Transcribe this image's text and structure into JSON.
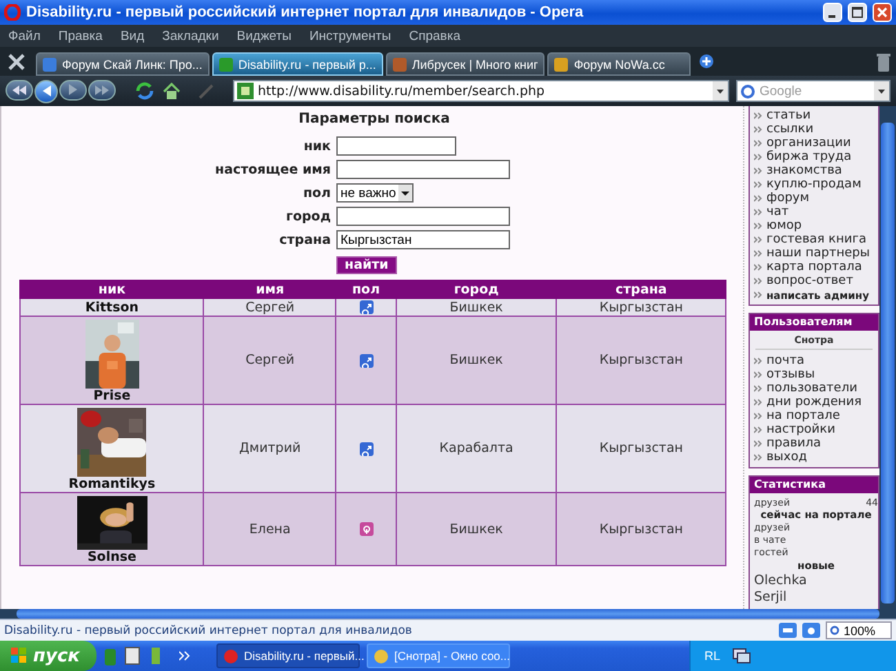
{
  "window": {
    "title": "Disability.ru - первый российский интернет портал для инвалидов - Opera"
  },
  "menu": [
    "Файл",
    "Правка",
    "Вид",
    "Закладки",
    "Виджеты",
    "Инструменты",
    "Справка"
  ],
  "tabs": [
    {
      "label": "Форум Скай Линк: Про...",
      "selected": false
    },
    {
      "label": "Disability.ru - первый р...",
      "selected": true
    },
    {
      "label": "Либрусек | Много книг",
      "selected": false
    },
    {
      "label": "Форум NoWa.cc",
      "selected": false
    }
  ],
  "address_bar": {
    "url": "http://www.disability.ru/member/search.php"
  },
  "search": {
    "placeholder": "Google"
  },
  "search_form": {
    "title": "Параметры поиска",
    "fields": [
      {
        "label": "ник",
        "kind": "text"
      },
      {
        "label": "настоящее имя",
        "kind": "text"
      },
      {
        "label": "пол",
        "kind": "select",
        "value": "не важно"
      },
      {
        "label": "город",
        "kind": "text"
      },
      {
        "label": "страна",
        "kind": "text",
        "value": "Кыргызстан"
      }
    ],
    "button": "найти"
  },
  "results": {
    "columns": [
      "ник",
      "имя",
      "пол",
      "город",
      "страна"
    ],
    "rows": [
      {
        "nick": "Kittson",
        "name": "Сергей",
        "female": false,
        "city": "Бишкек",
        "country": "Кыргызстан"
      },
      {
        "nick": "Prise",
        "name": "Сергей",
        "female": false,
        "city": "Бишкек",
        "country": "Кыргызстан"
      },
      {
        "nick": "Romantikys",
        "name": "Дмитрий",
        "female": false,
        "city": "Карабалта",
        "country": "Кыргызстан"
      },
      {
        "nick": "Solnse",
        "name": "Елена",
        "female": true,
        "city": "Бишкек",
        "country": "Кыргызстан"
      }
    ]
  },
  "sidebar": {
    "links": [
      "статьи",
      "ссылки",
      "организации",
      "биржа труда",
      "знакомства",
      "куплю-продам",
      "форум",
      "чат",
      "юмор",
      "гостевая книга",
      "наши партнеры",
      "карта портала",
      "вопрос-ответ",
      "написать админу"
    ],
    "users_panel": {
      "title": "Пользователям",
      "user": "Снотра",
      "links": [
        "почта",
        "отзывы",
        "пользователи",
        "дни рождения",
        "на портале",
        "настройки",
        "правила",
        "выход"
      ]
    },
    "stats_panel": {
      "title": "Статистика",
      "rows": [
        {
          "kind": "count",
          "label": "друзей",
          "value": "44"
        },
        {
          "kind": "heading",
          "label": "сейчас на портале"
        },
        {
          "kind": "item",
          "label": "друзей"
        },
        {
          "kind": "item",
          "label": "в чате"
        },
        {
          "kind": "item",
          "label": "гостей"
        },
        {
          "kind": "heading",
          "label": "новые"
        },
        {
          "kind": "user",
          "label": "Olechka"
        },
        {
          "kind": "user",
          "label": "Serjil"
        }
      ]
    }
  },
  "status_bar": {
    "text": "Disability.ru - первый российский интернет портал для инвалидов",
    "zoom": "100%"
  },
  "taskbar": {
    "start": "пуск",
    "tasks": [
      {
        "label": "Disability.ru - первый...",
        "selected": true
      },
      {
        "label": "[Снотра] - Окно соо...",
        "selected": false
      }
    ],
    "tray": "RL"
  }
}
